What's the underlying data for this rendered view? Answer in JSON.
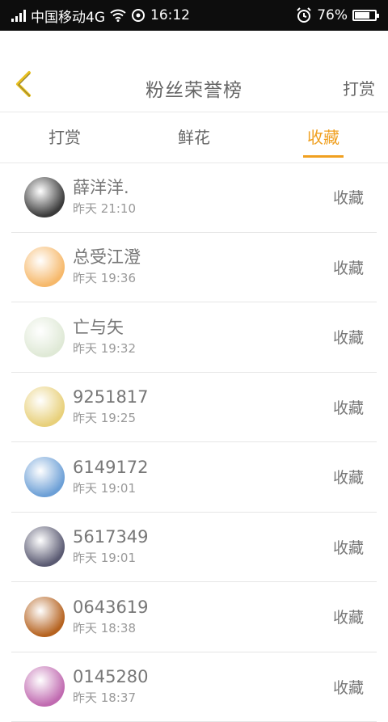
{
  "status_bar": {
    "carrier": "中国移动4G",
    "time": "16:12",
    "battery_percent": "76%",
    "battery_level": 0.76
  },
  "header": {
    "title": "粉丝荣誉榜",
    "right_action": "打赏"
  },
  "tabs": [
    {
      "label": "打赏",
      "active": false
    },
    {
      "label": "鲜花",
      "active": false
    },
    {
      "label": "收藏",
      "active": true
    }
  ],
  "colors": {
    "accent": "#f0a020",
    "back_icon": "#e8c020"
  },
  "rows": [
    {
      "name": "薛洋洋.",
      "time": "昨天 21:10",
      "action": "收藏",
      "avatar_color": "#3a3a3a"
    },
    {
      "name": "总受江澄",
      "time": "昨天 19:36",
      "action": "收藏",
      "avatar_color": "#f6b86a"
    },
    {
      "name": "亡与矢",
      "time": "昨天 19:32",
      "action": "收藏",
      "avatar_color": "#dfe9d6"
    },
    {
      "name": "9251817",
      "time": "昨天 19:25",
      "action": "收藏",
      "avatar_color": "#e8d07a"
    },
    {
      "name": "6149172",
      "time": "昨天 19:01",
      "action": "收藏",
      "avatar_color": "#6c9fd6"
    },
    {
      "name": "5617349",
      "time": "昨天 19:01",
      "action": "收藏",
      "avatar_color": "#5a5a72"
    },
    {
      "name": "0643619",
      "time": "昨天 18:38",
      "action": "收藏",
      "avatar_color": "#b5621f"
    },
    {
      "name": "0145280",
      "time": "昨天 18:37",
      "action": "收藏",
      "avatar_color": "#c06ab0"
    }
  ]
}
